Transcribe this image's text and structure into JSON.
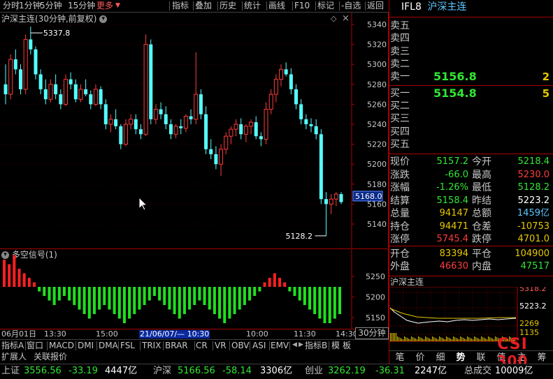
{
  "toolbar": {
    "items": [
      "分时",
      "1分钟",
      "5分钟",
      "15分钟",
      "更多",
      "指标",
      "叠加",
      "历史",
      "统计",
      "画线",
      "F10",
      "标记",
      "-自选",
      "返回"
    ]
  },
  "chart_header": {
    "title": "沪深主连(30分钟,前复权)"
  },
  "chart_data": [
    {
      "type": "candlestick",
      "title": "沪深主连(30分钟,前复权)",
      "y_ticks": [
        5340,
        5320,
        5300,
        5280,
        5260,
        5240,
        5220,
        5200,
        5180,
        5160,
        5140
      ],
      "ylim": [
        5125,
        5345
      ],
      "price_marker": "5168.0",
      "max_label": "5337.8",
      "min_label": "5128.2",
      "x_labels": [
        "06月01日",
        "13:30",
        "15:00",
        "21/06/07/— 10:30",
        "10:00",
        "11:30",
        "14:30"
      ],
      "x_period": "30分钟",
      "candles": [
        [
          5280,
          5300,
          5260,
          5270
        ],
        [
          5270,
          5310,
          5265,
          5305
        ],
        [
          5305,
          5315,
          5290,
          5295
        ],
        [
          5295,
          5300,
          5270,
          5275
        ],
        [
          5275,
          5330,
          5270,
          5325
        ],
        [
          5325,
          5337.8,
          5310,
          5315
        ],
        [
          5315,
          5318,
          5285,
          5290
        ],
        [
          5290,
          5295,
          5270,
          5275
        ],
        [
          5275,
          5285,
          5260,
          5265
        ],
        [
          5265,
          5285,
          5262,
          5280
        ],
        [
          5280,
          5290,
          5265,
          5270
        ],
        [
          5270,
          5275,
          5255,
          5260
        ],
        [
          5260,
          5290,
          5258,
          5285
        ],
        [
          5285,
          5292,
          5275,
          5280
        ],
        [
          5280,
          5285,
          5262,
          5265
        ],
        [
          5265,
          5280,
          5262,
          5275
        ],
        [
          5275,
          5285,
          5268,
          5270
        ],
        [
          5270,
          5274,
          5255,
          5260
        ],
        [
          5260,
          5280,
          5258,
          5275
        ],
        [
          5275,
          5278,
          5255,
          5260
        ],
        [
          5260,
          5265,
          5235,
          5240
        ],
        [
          5240,
          5250,
          5232,
          5245
        ],
        [
          5245,
          5255,
          5235,
          5238
        ],
        [
          5238,
          5240,
          5215,
          5220
        ],
        [
          5220,
          5245,
          5218,
          5240
        ],
        [
          5240,
          5250,
          5235,
          5245
        ],
        [
          5245,
          5250,
          5230,
          5235
        ],
        [
          5235,
          5240,
          5225,
          5230
        ],
        [
          5230,
          5330,
          5228,
          5320
        ],
        [
          5320,
          5325,
          5240,
          5245
        ],
        [
          5245,
          5260,
          5240,
          5255
        ],
        [
          5255,
          5262,
          5245,
          5250
        ],
        [
          5250,
          5258,
          5235,
          5240
        ],
        [
          5240,
          5245,
          5225,
          5230
        ],
        [
          5230,
          5240,
          5226,
          5238
        ],
        [
          5238,
          5245,
          5230,
          5236
        ],
        [
          5236,
          5250,
          5232,
          5248
        ],
        [
          5248,
          5255,
          5240,
          5245
        ],
        [
          5245,
          5312,
          5240,
          5270
        ],
        [
          5270,
          5275,
          5245,
          5250
        ],
        [
          5250,
          5258,
          5210,
          5215
        ],
        [
          5215,
          5225,
          5205,
          5210
        ],
        [
          5210,
          5218,
          5195,
          5200
        ],
        [
          5200,
          5220,
          5188,
          5215
        ],
        [
          5215,
          5232,
          5210,
          5228
        ],
        [
          5228,
          5238,
          5220,
          5235
        ],
        [
          5235,
          5245,
          5228,
          5240
        ],
        [
          5240,
          5246,
          5225,
          5230
        ],
        [
          5230,
          5240,
          5222,
          5238
        ],
        [
          5238,
          5245,
          5230,
          5242
        ],
        [
          5242,
          5248,
          5225,
          5228
        ],
        [
          5228,
          5232,
          5218,
          5225
        ],
        [
          5225,
          5262,
          5220,
          5255
        ],
        [
          5255,
          5275,
          5250,
          5270
        ],
        [
          5270,
          5290,
          5262,
          5285
        ],
        [
          5285,
          5300,
          5278,
          5295
        ],
        [
          5295,
          5302,
          5288,
          5290
        ],
        [
          5290,
          5296,
          5270,
          5275
        ],
        [
          5275,
          5280,
          5255,
          5260
        ],
        [
          5260,
          5265,
          5240,
          5245
        ],
        [
          5245,
          5250,
          5235,
          5240
        ],
        [
          5240,
          5246,
          5232,
          5238
        ],
        [
          5238,
          5245,
          5225,
          5230
        ],
        [
          5230,
          5235,
          5160,
          5165
        ],
        [
          5165,
          5172,
          5128.2,
          5160
        ],
        [
          5160,
          5170,
          5150,
          5165
        ],
        [
          5165,
          5172,
          5158,
          5170
        ],
        [
          5170,
          5172,
          5160,
          5162
        ]
      ]
    },
    {
      "type": "bar",
      "title": "多空信号(1)",
      "y_ticks": [
        5250,
        5200,
        5150
      ],
      "ylim": [
        5140,
        5260
      ],
      "values": [
        6,
        5,
        7,
        4,
        3,
        2,
        1,
        -1,
        -2,
        -3,
        -4,
        -3,
        -2,
        -3,
        -4,
        -5,
        -6,
        -7,
        -6,
        -5,
        -4,
        -5,
        -6,
        -7,
        -8,
        -7,
        -6,
        -5,
        -4,
        -3,
        -2,
        -3,
        -4,
        -5,
        -6,
        -7,
        -6,
        -5,
        -4,
        -3,
        -4,
        -5,
        -6,
        -7,
        -8,
        -7,
        -6,
        -5,
        -4,
        -3,
        -2,
        -1,
        1,
        2,
        3,
        2,
        1,
        -1,
        -2,
        -3,
        -4,
        -5,
        -6,
        -7,
        -8,
        -8,
        -7,
        -6
      ]
    }
  ],
  "quote": {
    "code": "IFL8",
    "name": "沪深主连",
    "sell": [
      {
        "label": "卖五",
        "price": "",
        "vol": ""
      },
      {
        "label": "卖四",
        "price": "",
        "vol": ""
      },
      {
        "label": "卖三",
        "price": "",
        "vol": ""
      },
      {
        "label": "卖二",
        "price": "",
        "vol": ""
      },
      {
        "label": "卖一",
        "price": "5156.8",
        "vol": "2"
      }
    ],
    "buy": [
      {
        "label": "买一",
        "price": "5154.8",
        "vol": "5"
      },
      {
        "label": "买二",
        "price": "",
        "vol": ""
      },
      {
        "label": "买三",
        "price": "",
        "vol": ""
      },
      {
        "label": "买四",
        "price": "",
        "vol": ""
      },
      {
        "label": "买五",
        "price": "",
        "vol": ""
      }
    ],
    "stats": [
      [
        "现价",
        "5157.2",
        "今开",
        "5218.4"
      ],
      [
        "涨跌",
        "-66.0",
        "最高",
        "5230.0"
      ],
      [
        "涨幅",
        "-1.26%",
        "最低",
        "5128.2"
      ],
      [
        "结算",
        "5158.4",
        "昨结",
        "5223.2"
      ],
      [
        "总量",
        "94147",
        "总额",
        "1459亿"
      ],
      [
        "持仓",
        "94471",
        "仓差",
        "-10753"
      ],
      [
        "涨停",
        "5745.4",
        "跌停",
        "4701.0"
      ]
    ],
    "stats2": [
      [
        "开仓",
        "83394",
        "平仓",
        "104900"
      ],
      [
        "外盘",
        "46630",
        "内盘",
        "47517"
      ]
    ]
  },
  "mini": {
    "title": "沪深主连",
    "levels": [
      "5318.2",
      "5223.2",
      "2269",
      "1135"
    ]
  },
  "bottom_tabs": [
    "指标A",
    "窗口",
    "MACD",
    "DMI",
    "DMA",
    "FSL",
    "TRIX",
    "BRAR",
    "CR",
    "VR",
    "OBV",
    "ASI",
    "EMV",
    "",
    "指标B",
    "模",
    "板"
  ],
  "period_box": "30分钟",
  "sub_tabs": [
    "扩展人",
    "关联报价"
  ],
  "right_tabs": [
    "笔",
    "价",
    "细",
    "势",
    "联",
    "值",
    "主",
    "筹"
  ],
  "logo": {
    "top": "CSI",
    "bottom": "300"
  },
  "statusbar": {
    "items": [
      {
        "name": "上证",
        "price": "3556.56",
        "chg": "-33.19",
        "amt": "4447亿"
      },
      {
        "name": "沪深",
        "price": "5166.56",
        "chg": "-58.14",
        "amt": "3306亿"
      },
      {
        "name": "创业",
        "price": "3262.19",
        "chg": "-36.31",
        "amt": "2247亿"
      }
    ],
    "total_label": "总成交",
    "total_value": "10009亿"
  }
}
